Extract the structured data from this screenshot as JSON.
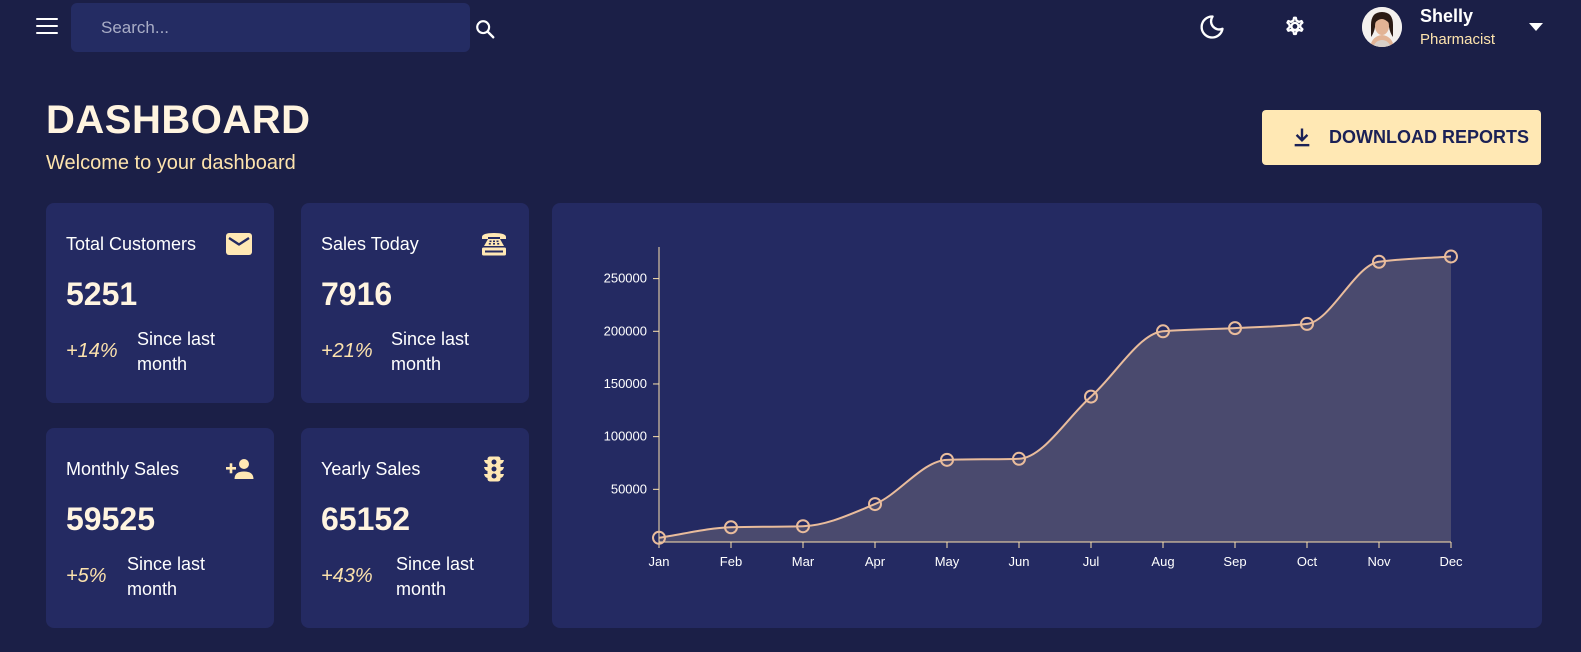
{
  "topbar": {
    "search": {
      "placeholder": "Search...",
      "value": ""
    },
    "icons": {
      "menu": "menu-icon",
      "search": "search-icon",
      "theme": "moon-icon",
      "settings": "gear-icon",
      "caret": "caret-down-icon"
    },
    "user": {
      "name": "Shelly",
      "role": "Pharmacist"
    }
  },
  "header": {
    "title": "DASHBOARD",
    "subtitle": "Welcome to your dashboard",
    "download_label": "DOWNLOAD REPORTS"
  },
  "cards": [
    {
      "title": "Total Customers",
      "value": "5251",
      "change": "+14%",
      "since": "Since last month",
      "icon": "mail-icon"
    },
    {
      "title": "Sales Today",
      "value": "7916",
      "change": "+21%",
      "since": "Since last month",
      "icon": "fax-icon"
    },
    {
      "title": "Monthly Sales",
      "value": "59525",
      "change": "+5%",
      "since": "Since last month",
      "icon": "person-add-icon"
    },
    {
      "title": "Yearly Sales",
      "value": "65152",
      "change": "+43%",
      "since": "Since last month",
      "icon": "traffic-icon"
    }
  ],
  "colors": {
    "background": "#1b1f47",
    "panel": "#242a62",
    "accent": "#ffe8b4",
    "line": "#e9bc9c",
    "area": "#4a4a6e"
  },
  "chart_data": {
    "type": "area",
    "categories": [
      "Jan",
      "Feb",
      "Mar",
      "Apr",
      "May",
      "Jun",
      "Jul",
      "Aug",
      "Sep",
      "Oct",
      "Nov",
      "Dec"
    ],
    "values": [
      4000,
      14000,
      15000,
      36000,
      78000,
      79000,
      138000,
      200000,
      203000,
      207000,
      266000,
      271000
    ],
    "yticks": [
      50000,
      100000,
      150000,
      200000,
      250000
    ],
    "ylim": [
      0,
      280000
    ],
    "title": "",
    "xlabel": "",
    "ylabel": "",
    "grid": false,
    "curve": "smooth",
    "markers": "open-circle"
  }
}
